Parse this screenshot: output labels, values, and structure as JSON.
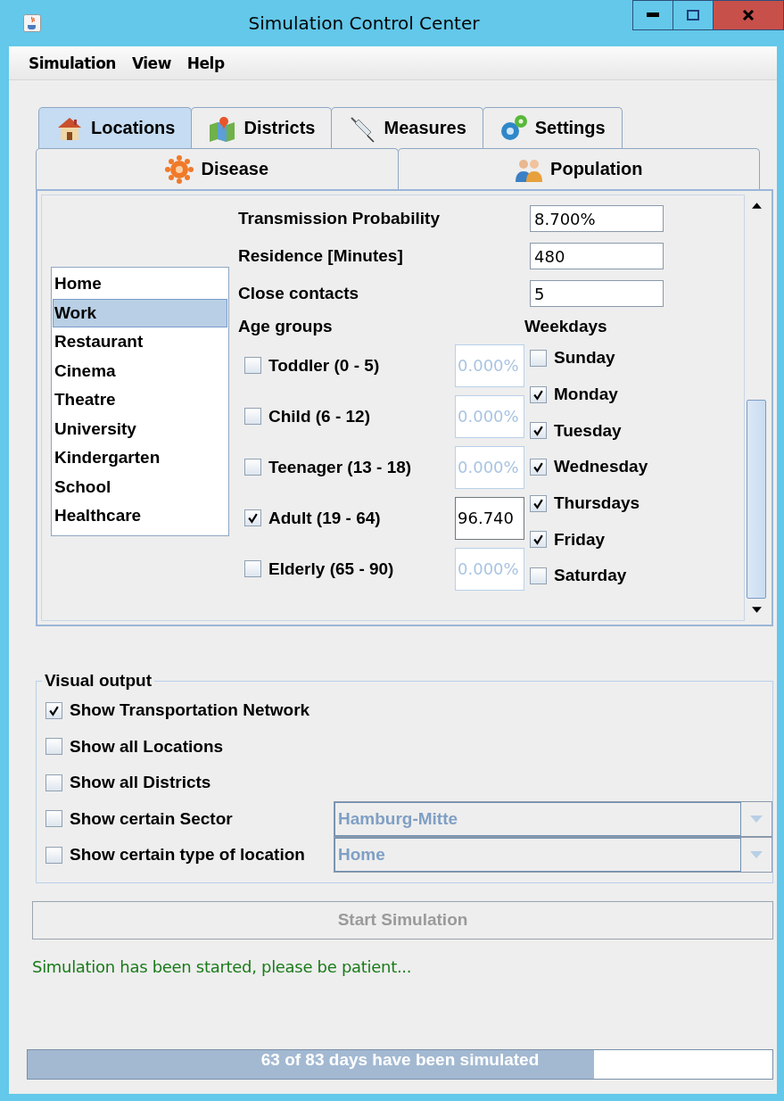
{
  "window": {
    "title": "Simulation Control Center"
  },
  "menu": [
    "Simulation",
    "View",
    "Help"
  ],
  "tabs_row1": [
    {
      "label": "Locations",
      "kind": "house",
      "selected": true
    },
    {
      "label": "Districts",
      "kind": "map",
      "selected": false
    },
    {
      "label": "Measures",
      "kind": "syringe",
      "selected": false
    },
    {
      "label": "Settings",
      "kind": "gears",
      "selected": false
    }
  ],
  "tabs_row2": [
    {
      "label": "Disease",
      "kind": "virus",
      "selected": false
    },
    {
      "label": "Population",
      "kind": "people",
      "selected": false
    }
  ],
  "locations": [
    {
      "label": "Home",
      "selected": false
    },
    {
      "label": "Work",
      "selected": true
    },
    {
      "label": "Restaurant",
      "selected": false
    },
    {
      "label": "Cinema",
      "selected": false
    },
    {
      "label": "Theatre",
      "selected": false
    },
    {
      "label": "University",
      "selected": false
    },
    {
      "label": "Kindergarten",
      "selected": false
    },
    {
      "label": "School",
      "selected": false
    },
    {
      "label": "Healthcare",
      "selected": false
    }
  ],
  "fields": [
    {
      "label": "Transmission Probability",
      "value": "8.700%"
    },
    {
      "label": "Residence [Minutes]",
      "value": "480"
    },
    {
      "label": "Close contacts",
      "value": "5"
    }
  ],
  "age_groups": {
    "title": "Age groups",
    "items": [
      {
        "label": "Toddler (0 - 5)",
        "checked": false,
        "value": "0.000%"
      },
      {
        "label": "Child (6 - 12)",
        "checked": false,
        "value": "0.000%"
      },
      {
        "label": "Teenager (13 - 18)",
        "checked": false,
        "value": "0.000%"
      },
      {
        "label": "Adult (19 - 64)",
        "checked": true,
        "value": "96.740"
      },
      {
        "label": "Elderly (65 - 90)",
        "checked": false,
        "value": "0.000%"
      }
    ]
  },
  "weekdays": {
    "title": "Weekdays",
    "items": [
      {
        "label": "Sunday",
        "checked": false
      },
      {
        "label": "Monday",
        "checked": true
      },
      {
        "label": "Tuesday",
        "checked": true
      },
      {
        "label": "Wednesday",
        "checked": true
      },
      {
        "label": "Thursdays",
        "checked": true
      },
      {
        "label": "Friday",
        "checked": true
      },
      {
        "label": "Saturday",
        "checked": false
      }
    ]
  },
  "visual_output": {
    "title": "Visual output",
    "options": [
      {
        "label": "Show Transportation Network",
        "checked": true
      },
      {
        "label": "Show all Locations",
        "checked": false
      },
      {
        "label": "Show all Districts",
        "checked": false
      },
      {
        "label": "Show certain Sector",
        "checked": false,
        "combo": {
          "value": "Hamburg-Mitte",
          "disabled": true
        }
      },
      {
        "label": "Show certain type of location",
        "checked": false,
        "combo": {
          "value": "Home",
          "disabled": true
        }
      }
    ]
  },
  "start_button": {
    "label": "Start Simulation",
    "disabled": true
  },
  "status": "Simulation has been started, please be patient...",
  "progress": {
    "label": "63 of 83 days have been simulated",
    "level": 0.76
  }
}
